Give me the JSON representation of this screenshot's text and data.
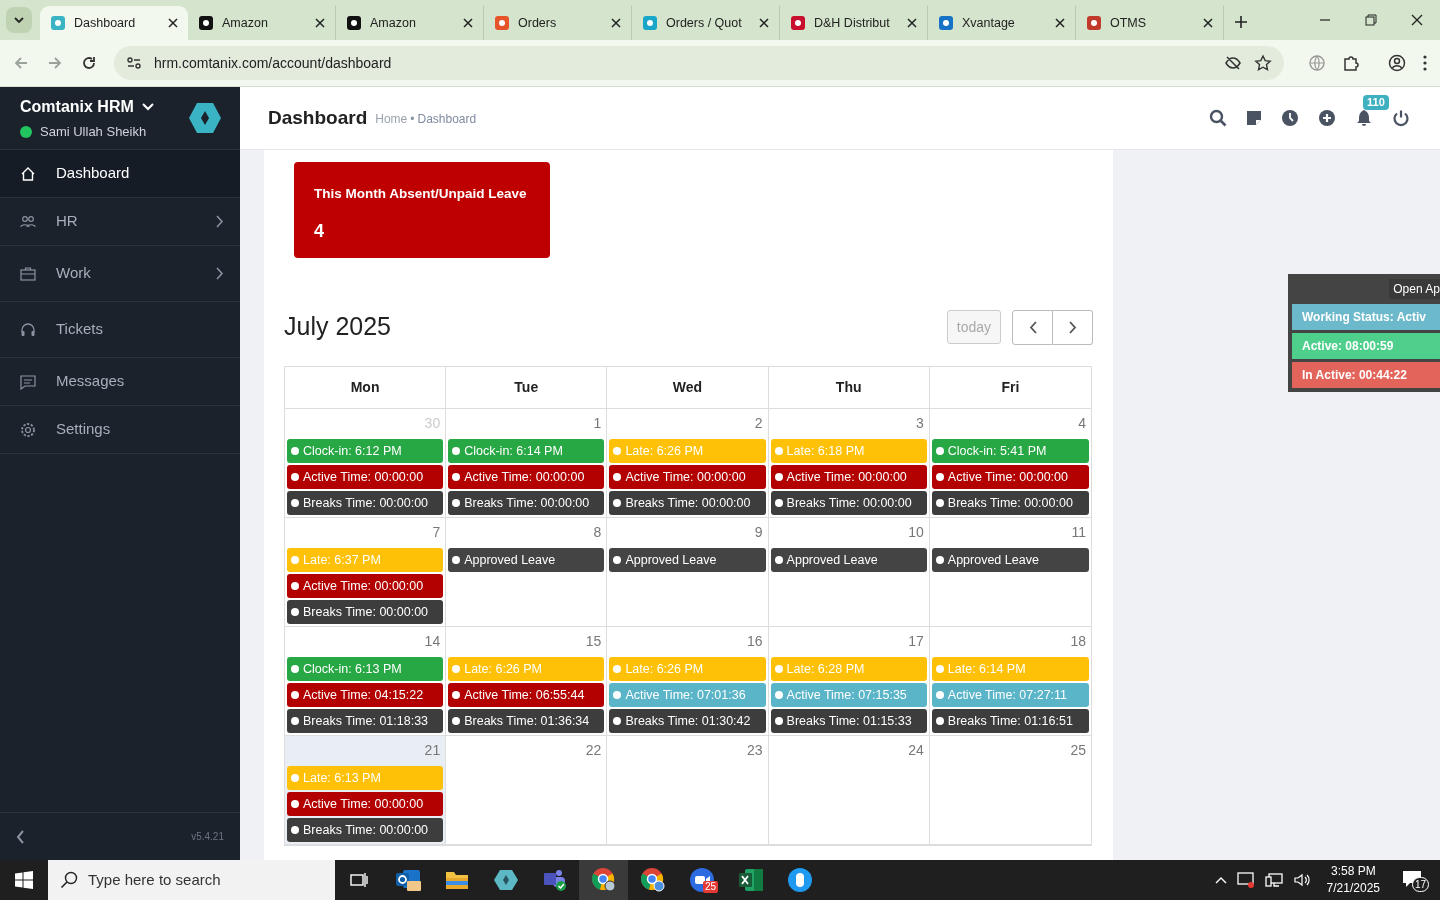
{
  "browser": {
    "tabs": [
      {
        "title": "Dashboard",
        "selected": true
      },
      {
        "title": "Amazon",
        "selected": false
      },
      {
        "title": "Amazon",
        "selected": false
      },
      {
        "title": "Orders",
        "selected": false
      },
      {
        "title": "Orders / Quot",
        "selected": false
      },
      {
        "title": "D&H Distribut",
        "selected": false
      },
      {
        "title": "Xvantage",
        "selected": false
      },
      {
        "title": "OTMS",
        "selected": false
      }
    ],
    "url": "hrm.comtanix.com/account/dashboard"
  },
  "sidebar": {
    "brand": "Comtanix HRM",
    "user": "Sami Ullah Sheikh",
    "online": true,
    "items": [
      {
        "label": "Dashboard",
        "selected": true,
        "submenu": false
      },
      {
        "label": "HR",
        "selected": false,
        "submenu": true
      },
      {
        "label": "Work",
        "selected": false,
        "submenu": true
      },
      {
        "label": "Tickets",
        "selected": false,
        "submenu": false
      },
      {
        "label": "Messages",
        "selected": false,
        "submenu": false
      },
      {
        "label": "Settings",
        "selected": false,
        "submenu": false
      }
    ],
    "version": "v5.4.21"
  },
  "header": {
    "title": "Dashboard",
    "breadcrumb": [
      "Home",
      "Dashboard"
    ],
    "breadcrumb_separator": "•",
    "notifications": "110"
  },
  "stat_card": {
    "label": "This Month Absent/Unpaid Leave",
    "value": "4"
  },
  "calendar": {
    "title": "July 2025",
    "today_button": "today",
    "columns": [
      "Mon",
      "Tue",
      "Wed",
      "Thu",
      "Fri"
    ],
    "weeks": [
      [
        {
          "date": "30",
          "other_month": true,
          "today": false,
          "events": [
            {
              "text": "Clock-in: 6:12 PM",
              "color": "#28a745"
            },
            {
              "text": "Active Time: 00:00:00",
              "color": "#b30000"
            },
            {
              "text": "Breaks Time: 00:00:00",
              "color": "#3d3d3d"
            }
          ]
        },
        {
          "date": "1",
          "other_month": false,
          "today": false,
          "events": [
            {
              "text": "Clock-in: 6:14 PM",
              "color": "#28a745"
            },
            {
              "text": "Active Time: 00:00:00",
              "color": "#b30000"
            },
            {
              "text": "Breaks Time: 00:00:00",
              "color": "#3d3d3d"
            }
          ]
        },
        {
          "date": "2",
          "other_month": false,
          "today": false,
          "events": [
            {
              "text": "Late: 6:26 PM",
              "color": "#ffc107"
            },
            {
              "text": "Active Time: 00:00:00",
              "color": "#b30000"
            },
            {
              "text": "Breaks Time: 00:00:00",
              "color": "#3d3d3d"
            }
          ]
        },
        {
          "date": "3",
          "other_month": false,
          "today": false,
          "events": [
            {
              "text": "Late: 6:18 PM",
              "color": "#ffc107"
            },
            {
              "text": "Active Time: 00:00:00",
              "color": "#b30000"
            },
            {
              "text": "Breaks Time: 00:00:00",
              "color": "#3d3d3d"
            }
          ]
        },
        {
          "date": "4",
          "other_month": false,
          "today": false,
          "events": [
            {
              "text": "Clock-in: 5:41 PM",
              "color": "#28a745"
            },
            {
              "text": "Active Time: 00:00:00",
              "color": "#b30000"
            },
            {
              "text": "Breaks Time: 00:00:00",
              "color": "#3d3d3d"
            }
          ]
        }
      ],
      [
        {
          "date": "7",
          "other_month": false,
          "today": false,
          "events": [
            {
              "text": "Late: 6:37 PM",
              "color": "#ffc107"
            },
            {
              "text": "Active Time: 00:00:00",
              "color": "#b30000"
            },
            {
              "text": "Breaks Time: 00:00:00",
              "color": "#3d3d3d"
            }
          ]
        },
        {
          "date": "8",
          "other_month": false,
          "today": false,
          "events": [
            {
              "text": "Approved Leave",
              "color": "#444444"
            }
          ]
        },
        {
          "date": "9",
          "other_month": false,
          "today": false,
          "events": [
            {
              "text": "Approved Leave",
              "color": "#444444"
            }
          ]
        },
        {
          "date": "10",
          "other_month": false,
          "today": false,
          "events": [
            {
              "text": "Approved Leave",
              "color": "#444444"
            }
          ]
        },
        {
          "date": "11",
          "other_month": false,
          "today": false,
          "events": [
            {
              "text": "Approved Leave",
              "color": "#444444"
            }
          ]
        }
      ],
      [
        {
          "date": "14",
          "other_month": false,
          "today": false,
          "events": [
            {
              "text": "Clock-in: 6:13 PM",
              "color": "#28a745"
            },
            {
              "text": "Active Time: 04:15:22",
              "color": "#b30000"
            },
            {
              "text": "Breaks Time: 01:18:33",
              "color": "#3d3d3d"
            }
          ]
        },
        {
          "date": "15",
          "other_month": false,
          "today": false,
          "events": [
            {
              "text": "Late: 6:26 PM",
              "color": "#ffc107"
            },
            {
              "text": "Active Time: 06:55:44",
              "color": "#b30000"
            },
            {
              "text": "Breaks Time: 01:36:34",
              "color": "#3d3d3d"
            }
          ]
        },
        {
          "date": "16",
          "other_month": false,
          "today": false,
          "events": [
            {
              "text": "Late: 6:26 PM",
              "color": "#ffc107"
            },
            {
              "text": "Active Time: 07:01:36",
              "color": "#5bb5c8"
            },
            {
              "text": "Breaks Time: 01:30:42",
              "color": "#3d3d3d"
            }
          ]
        },
        {
          "date": "17",
          "other_month": false,
          "today": false,
          "events": [
            {
              "text": "Late: 6:28 PM",
              "color": "#ffc107"
            },
            {
              "text": "Active Time: 07:15:35",
              "color": "#5bb5c8"
            },
            {
              "text": "Breaks Time: 01:15:33",
              "color": "#3d3d3d"
            }
          ]
        },
        {
          "date": "18",
          "other_month": false,
          "today": false,
          "events": [
            {
              "text": "Late: 6:14 PM",
              "color": "#ffc107"
            },
            {
              "text": "Active Time: 07:27:11",
              "color": "#5bb5c8"
            },
            {
              "text": "Breaks Time: 01:16:51",
              "color": "#3d3d3d"
            }
          ]
        }
      ],
      [
        {
          "date": "21",
          "other_month": false,
          "today": true,
          "events": [
            {
              "text": "Late: 6:13 PM",
              "color": "#ffc107"
            },
            {
              "text": "Active Time: 00:00:00",
              "color": "#b30000"
            },
            {
              "text": "Breaks Time: 00:00:00",
              "color": "#3d3d3d"
            }
          ]
        },
        {
          "date": "22",
          "other_month": false,
          "today": false
        },
        {
          "date": "23",
          "other_month": false,
          "today": false
        },
        {
          "date": "24",
          "other_month": false,
          "today": false
        },
        {
          "date": "25",
          "other_month": false,
          "today": false
        }
      ]
    ]
  },
  "status_widget": {
    "button": "Open Ap",
    "rows": [
      {
        "text": "Working Status: Activ",
        "color": "#6db9cc"
      },
      {
        "text": "Active: 08:00:59",
        "color": "#4fcf8c"
      },
      {
        "text": "In Active: 00:44:22",
        "color": "#e2645b"
      }
    ]
  },
  "taskbar": {
    "search_placeholder": "Type here to search",
    "zoom_badge": "25",
    "time": "3:58 PM",
    "date": "7/21/2025",
    "notification_count": "17"
  }
}
